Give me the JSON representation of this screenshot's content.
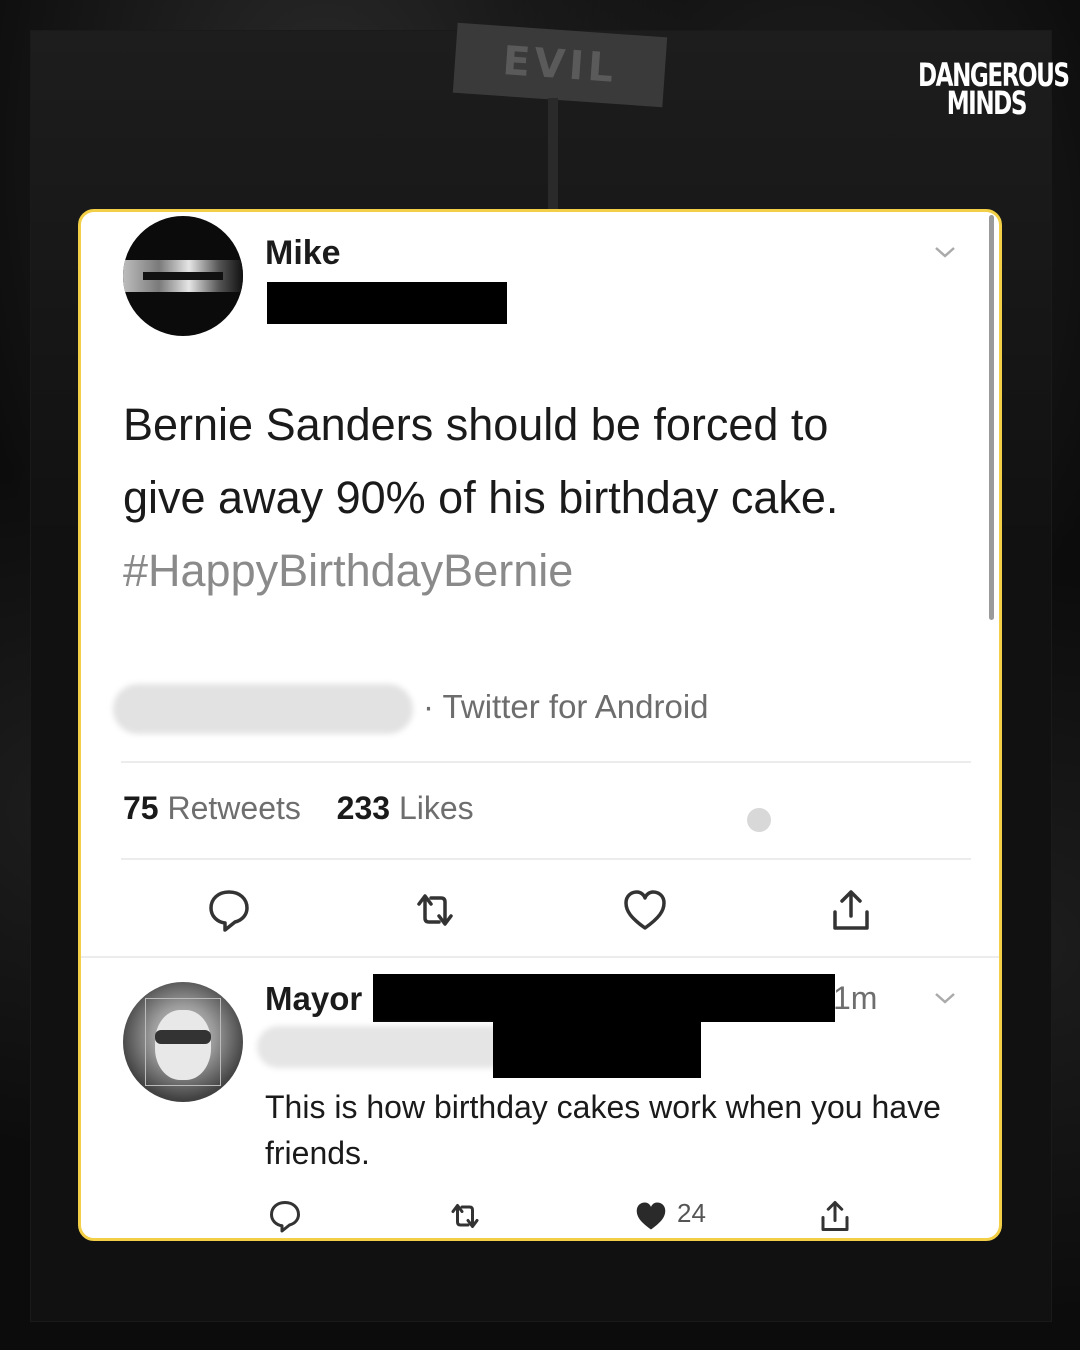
{
  "background": {
    "sign_text": "EVIL",
    "logo": {
      "line1": "DANGEROUS",
      "line2": "MINDS"
    }
  },
  "tweet": {
    "author_name": "Mike",
    "text_line1": "Bernie Sanders should be forced to",
    "text_line2": "give away 90% of his birthday cake.",
    "hashtag": "#HappyBirthdayBernie",
    "source": "· Twitter for Android",
    "retweets_count": "75",
    "retweets_label": "Retweets",
    "likes_count": "233",
    "likes_label": "Likes",
    "actions": [
      "reply-icon",
      "retweet-icon",
      "like-icon",
      "share-icon"
    ]
  },
  "reply": {
    "author_name": "Mayor",
    "time": "1m",
    "text": "This is how birthday cakes work when you have friends.",
    "like_count": "24",
    "actions": [
      "reply-icon",
      "retweet-icon",
      "like-filled-icon",
      "share-icon"
    ]
  },
  "colors": {
    "card_border": "#f2cf46",
    "card_bg": "#ffffff",
    "text": "#1a1a1a",
    "muted": "#6e6e6e"
  }
}
